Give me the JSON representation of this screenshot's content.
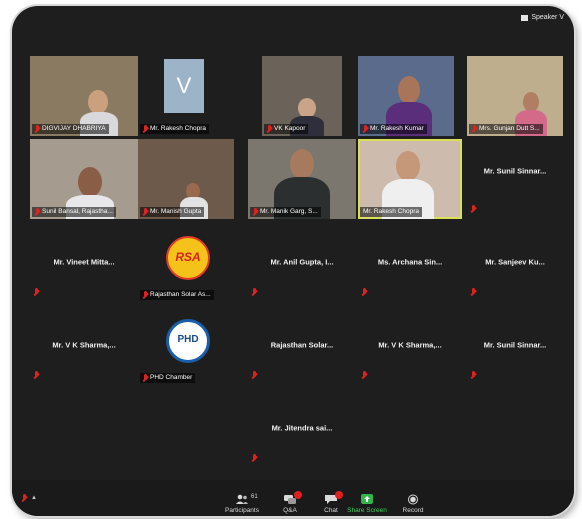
{
  "header": {
    "view_label": "Speaker V"
  },
  "tiles": [
    {
      "name": "DIGVIJAY DHABRIYA"
    },
    {
      "name": "Mr. Rakesh Chopra"
    },
    {
      "name": "VK Kapoor"
    },
    {
      "name": "Mr. Rakesh Kumar"
    },
    {
      "name": "Mrs. Gunjan Dutt S..."
    },
    {
      "name": "Sunil Bansal, Rajastha..."
    },
    {
      "name": "Mr. Manish Gupta"
    },
    {
      "name": "Mr. Manik Garg, S..."
    },
    {
      "name": "Mr. Rakesh Chopra"
    },
    {
      "name": "Mr. Sunil Sinnar..."
    },
    {
      "name": "Mr. Vineet Mitta..."
    },
    {
      "name": "Rajasthan Solar As..."
    },
    {
      "name": "Mr. Anil Gupta, I..."
    },
    {
      "name": "Ms. Archana Sin..."
    },
    {
      "name": "Mr. Sanjeev Ku..."
    },
    {
      "name": "Mr. V K Sharma,..."
    },
    {
      "name": "PHD Chamber"
    },
    {
      "name": "Rajasthan Solar..."
    },
    {
      "name": "Mr. V K Sharma,..."
    },
    {
      "name": "Mr. Sunil Sinnar..."
    },
    {
      "name": "Mr. Jitendra sai..."
    }
  ],
  "logos": {
    "rsa_text": "RSA",
    "phd_text": "PHD"
  },
  "view_letter": "V",
  "toolbar": {
    "participants_label": "Participants",
    "participants_count": "61",
    "qa_label": "Q&A",
    "chat_label": "Chat",
    "share_label": "Share Screen",
    "record_label": "Record"
  },
  "colors": {
    "background": "#1e1e1e",
    "active_speaker": "#d8e05a",
    "muted": "#dd2222",
    "share": "#2fb54a"
  }
}
